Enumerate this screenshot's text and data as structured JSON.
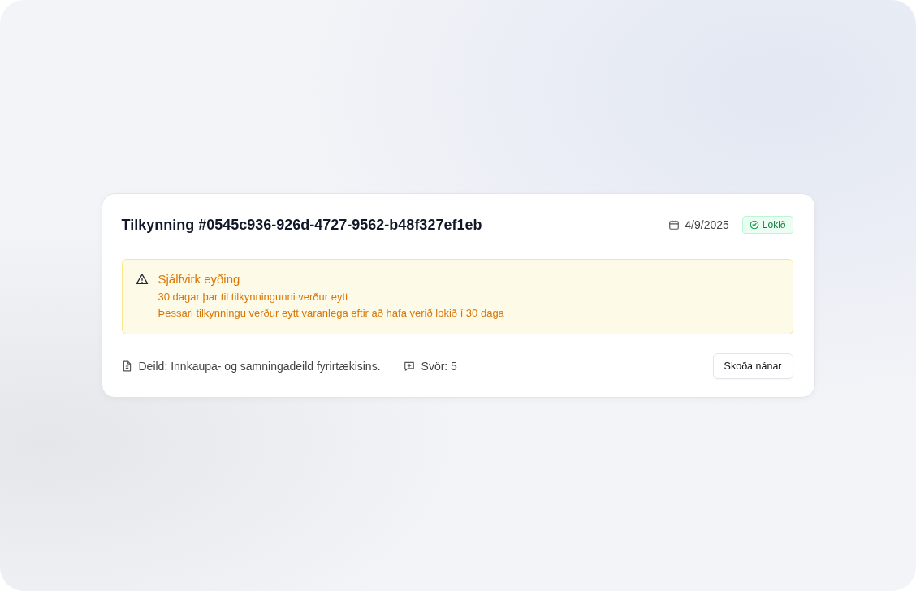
{
  "notice": {
    "title": "Tilkynning #0545c936-926d-4727-9562-b48f327ef1eb",
    "date": "4/9/2025",
    "status": {
      "label": "Lokið",
      "kind": "done"
    },
    "alert": {
      "title": "Sjálfvirk eyðing",
      "lines": [
        "30 dagar þar til tilkynningunni verður eytt",
        "Þessari tilkynningu verður eytt varanlega eftir að hafa verið lokið í 30 daga"
      ]
    },
    "department": "Deild: Innkaupa- og samningadeild fyrirtækisins.",
    "replies": "Svör: 5",
    "button": "Skoða nánar"
  }
}
